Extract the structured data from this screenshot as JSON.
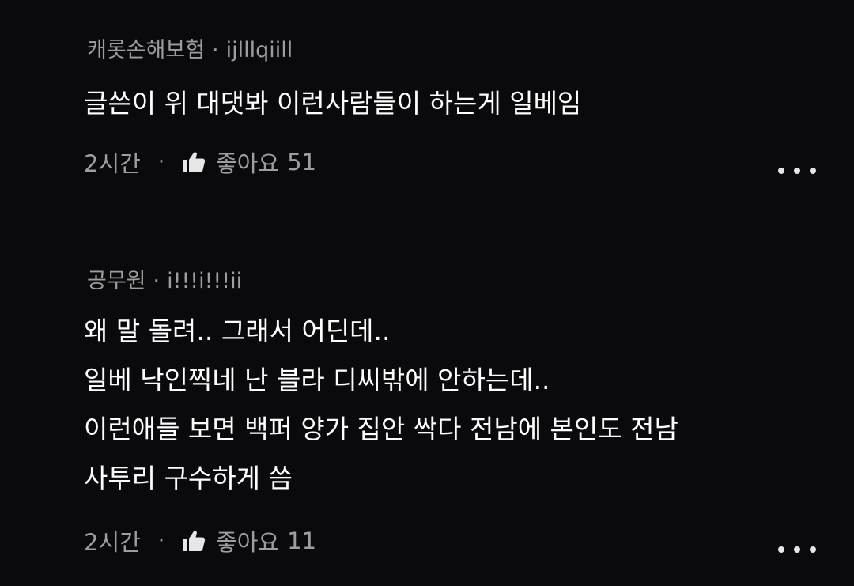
{
  "comments": [
    {
      "author": "캐롯손해보험",
      "separator": "·",
      "username": "ijlllqiill",
      "body_lines": [
        "글쓴이 위 대댓봐 이런사람들이 하는게 일베임"
      ],
      "time": "2시간",
      "meta_separator": "·",
      "like_label": "좋아요",
      "like_count": "51"
    },
    {
      "author": "공무원",
      "separator": "·",
      "username": "i!!!i!!!ii",
      "body_lines": [
        "왜 말 돌려.. 그래서 어딘데..",
        "일베 낙인찍네 난 블라 디씨밖에 안하는데..",
        "이런애들 보면 백퍼 양가 집안 싹다 전남에 본인도 전남",
        "사투리 구수하게 씀"
      ],
      "time": "2시간",
      "meta_separator": "·",
      "like_label": "좋아요",
      "like_count": "11"
    }
  ],
  "icons": {
    "like": "thumbs-up-icon",
    "more": "more-horizontal-icon"
  },
  "colors": {
    "background": "#0a0a0c",
    "primary_text": "#ffffff",
    "secondary_text": "#9e9e9e",
    "divider": "#2e2e30"
  }
}
